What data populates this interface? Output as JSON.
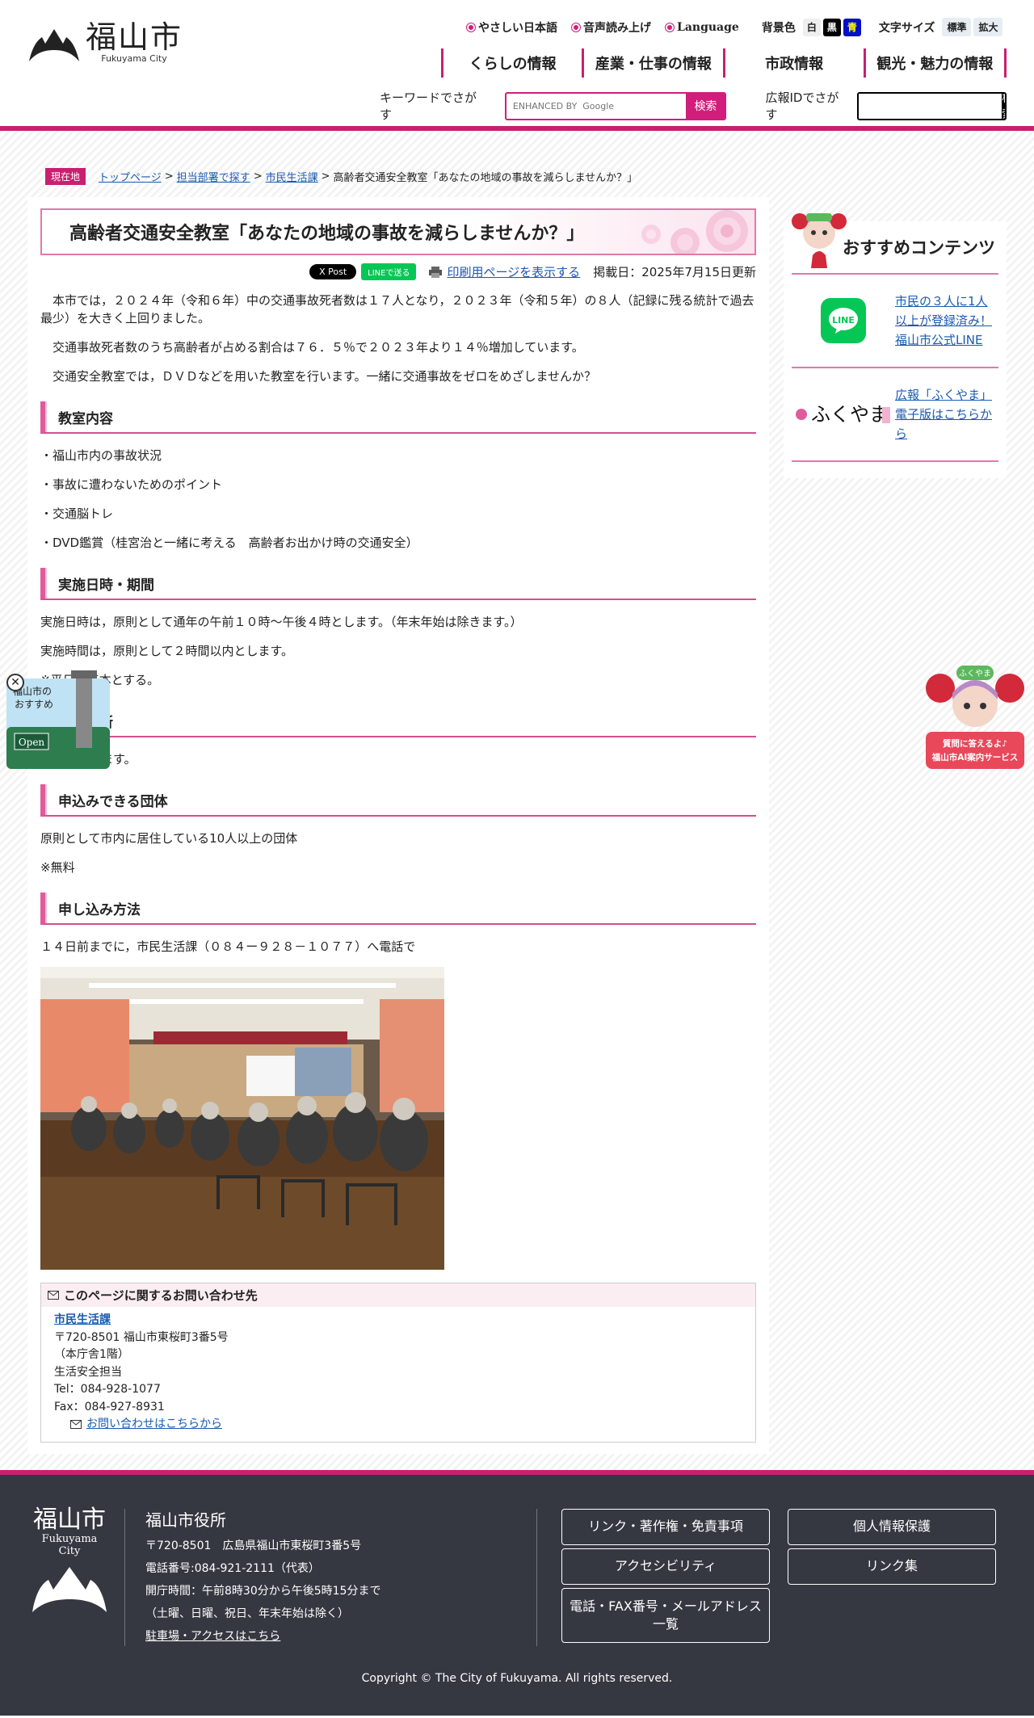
{
  "header": {
    "logo_jp": "福山市",
    "logo_en": "Fukuyama City",
    "util_links": [
      "やさしい日本語",
      "音声読み上げ",
      "Language"
    ],
    "bg_color_label": "背景色",
    "bg_colors": [
      "白",
      "黒",
      "青"
    ],
    "font_size_label": "文字サイズ",
    "font_sizes": [
      "標準",
      "拡大"
    ],
    "gnav": [
      "くらしの情報",
      "産業・仕事の情報",
      "市政情報",
      "観光・魅力の情報"
    ],
    "keyword_label": "キーワードでさがす",
    "google_placeholder": "ENHANCED BY  Google",
    "search_button": "検索",
    "id_label": "広報IDでさがす",
    "id_search_button": "検索"
  },
  "breadcrumb": {
    "here": "現在地",
    "items": [
      "トップページ",
      "担当部署で探す",
      "市民生活課"
    ],
    "current": "高齢者交通安全教室「あなたの地域の事故を減らしませんか？」"
  },
  "article": {
    "title": "高齢者交通安全教室「あなたの地域の事故を減らしませんか？」",
    "xpost": "X Post",
    "line": "LINEで送る",
    "print": "印刷用ページを表示する",
    "date": "掲載日：2025年7月15日更新",
    "intro": [
      "本市では，２０２４年（令和６年）中の交通事故死者数は１７人となり，２０２３年（令和５年）の８人（記録に残る統計で過去最少）を大きく上回りました。",
      "交通事故死者数のうち高齢者が占める割合は７６．５％で２０２３年より１４％増加しています。",
      "交通安全教室では，ＤＶＤなどを用いた教室を行います。一緒に交通事故をゼロをめざしませんか？"
    ],
    "h_content": "教室内容",
    "content_items": [
      "・福山市内の事故状況",
      "・事故に遭わないためのポイント",
      "・交通脳トレ",
      "・DVD鑑賞（桂宮治と一緒に考える　高齢者お出かけ時の交通安全）"
    ],
    "h_time": "実施日時・期間",
    "time_items": [
      "実施日時は，原則として通年の午前１０時～午後４時とします。（年末年始は除きます。）",
      "実施時間は，原則として２時間以内とします。",
      "※平日を基本とする。"
    ],
    "h_place": "開催場所",
    "place": "市内に限ります。",
    "h_group": "申込みできる団体",
    "group_items": [
      "原則として市内に居住している10人以上の団体",
      "※無料"
    ],
    "h_apply": "申し込み方法",
    "apply": "１４日前までに，市民生活課（０８４ー９２８－１０７７）へ電話で"
  },
  "inquiry": {
    "heading": "このページに関するお問い合わせ先",
    "dept": "市民生活課",
    "address": "〒720-8501 福山市東桜町3番5号",
    "floor": "（本庁舎1階）",
    "section": "生活安全担当",
    "tel": "Tel：084-928-1077",
    "fax": "Fax：084-927-8931",
    "form_link": "お問い合わせはこちらから"
  },
  "sidebar": {
    "heading": "おすすめコンテンツ",
    "items": [
      {
        "label": "市民の３人に1人以上が登録済み！福山市公式LINE",
        "icon": "line-icon"
      },
      {
        "label": "広報「ふくやま」電子版はこちらから",
        "icon": "fukuyama-logo",
        "logo_text": "ふくやま"
      }
    ]
  },
  "floating": {
    "left_label": "福山市の\nおすすめ",
    "left_open": "Open",
    "right_bubble": "ふくやま",
    "right_text1": "質問に答えるよ♪",
    "right_text2": "福山市AI案内サービス"
  },
  "footer": {
    "logo_jp": "福山市",
    "logo_en1": "Fukuyama",
    "logo_en2": "City",
    "name": "福山市役所",
    "address": "〒720-8501　広島県福山市東桜町3番5号",
    "phone": "電話番号:084-921-2111（代表）",
    "hours": "開庁時間：午前8時30分から午後5時15分まで",
    "closed": "（土曜、日曜、祝日、年末年始は除く）",
    "access": "駐車場・アクセスはこちら",
    "buttons": [
      "リンク・著作権・免責事項",
      "個人情報保護",
      "アクセシビリティ",
      "リンク集",
      "電話・FAX番号・メールアドレス一覧"
    ],
    "copyright": "Copyright © The City of Fukuyama. All rights reserved."
  },
  "colors": {
    "accent": "#c8206f",
    "footer_bg": "#353841",
    "link": "#1a5ab0",
    "line_green": "#06c755"
  }
}
